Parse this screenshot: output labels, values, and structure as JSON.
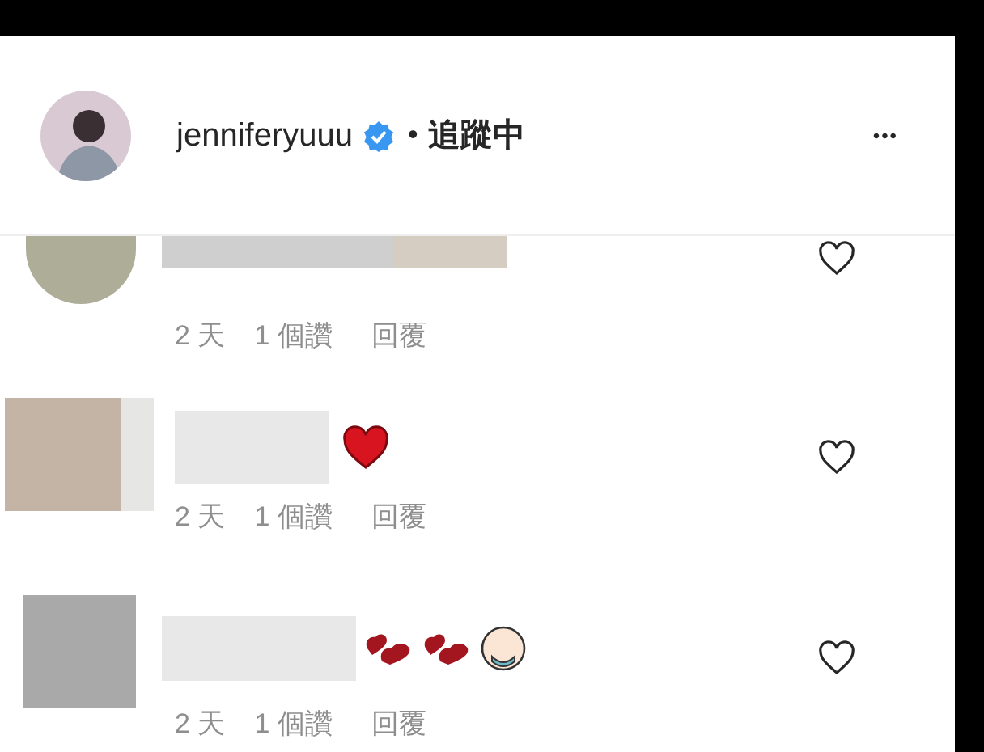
{
  "post_header": {
    "username": "jenniferyuuu",
    "verified": true,
    "separator": "•",
    "follow_status": "追蹤中",
    "more": "•••"
  },
  "comments": [
    {
      "kind": "plain",
      "time": "2 天",
      "likes": "1 個讚",
      "reply": "回覆",
      "liked": false
    },
    {
      "kind": "heart",
      "time": "2 天",
      "likes": "1 個讚",
      "reply": "回覆",
      "liked": false
    },
    {
      "kind": "hearts_baby",
      "time": "2 天",
      "likes": "1 個讚",
      "reply": "回覆",
      "liked": false
    }
  ]
}
